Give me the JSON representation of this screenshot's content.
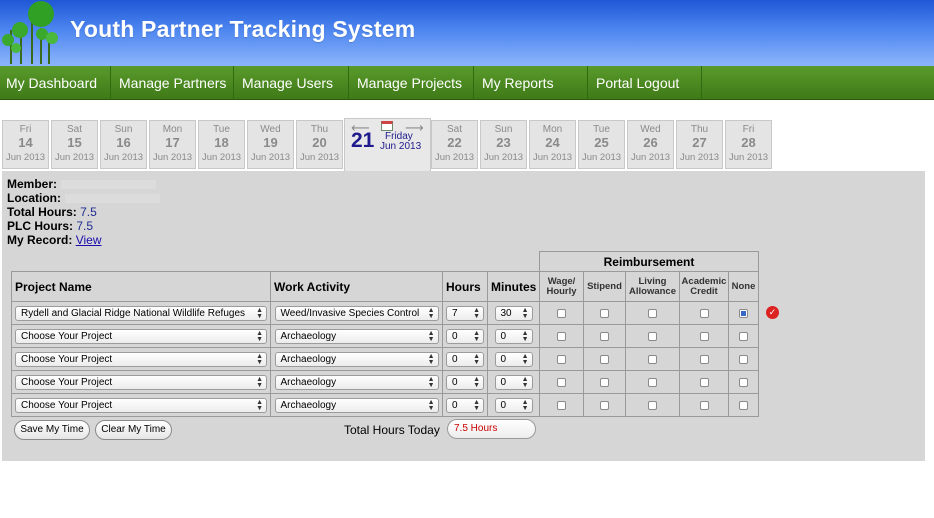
{
  "app": {
    "title": "Youth Partner Tracking System"
  },
  "nav": {
    "items": [
      {
        "label": "My Dashboard"
      },
      {
        "label": "Manage Partners"
      },
      {
        "label": "Manage Users"
      },
      {
        "label": "Manage Projects"
      },
      {
        "label": "My Reports"
      },
      {
        "label": "Portal Logout"
      }
    ]
  },
  "dates": {
    "before": [
      {
        "dayname": "Fri",
        "day": "14",
        "month": "Jun 2013"
      },
      {
        "dayname": "Sat",
        "day": "15",
        "month": "Jun 2013"
      },
      {
        "dayname": "Sun",
        "day": "16",
        "month": "Jun 2013"
      },
      {
        "dayname": "Mon",
        "day": "17",
        "month": "Jun 2013"
      },
      {
        "dayname": "Tue",
        "day": "18",
        "month": "Jun 2013"
      },
      {
        "dayname": "Wed",
        "day": "19",
        "month": "Jun 2013"
      },
      {
        "dayname": "Thu",
        "day": "20",
        "month": "Jun 2013"
      }
    ],
    "active": {
      "day": "21",
      "dayname": "Friday",
      "month": "Jun 2013"
    },
    "after": [
      {
        "dayname": "Sat",
        "day": "22",
        "month": "Jun 2013"
      },
      {
        "dayname": "Sun",
        "day": "23",
        "month": "Jun 2013"
      },
      {
        "dayname": "Mon",
        "day": "24",
        "month": "Jun 2013"
      },
      {
        "dayname": "Tue",
        "day": "25",
        "month": "Jun 2013"
      },
      {
        "dayname": "Wed",
        "day": "26",
        "month": "Jun 2013"
      },
      {
        "dayname": "Thu",
        "day": "27",
        "month": "Jun 2013"
      },
      {
        "dayname": "Fri",
        "day": "28",
        "month": "Jun 2013"
      }
    ]
  },
  "info": {
    "member_label": "Member:",
    "location_label": "Location:",
    "total_hours_label": "Total Hours:",
    "total_hours_value": "7.5",
    "plc_hours_label": "PLC Hours:",
    "plc_hours_value": "7.5",
    "record_label": "My Record:",
    "record_link": "View"
  },
  "table": {
    "reimbursement_title": "Reimbursement",
    "headers": {
      "project": "Project Name",
      "activity": "Work Activity",
      "hours": "Hours",
      "minutes": "Minutes",
      "wage": "Wage/ Hourly",
      "stipend": "Stipend",
      "living": "Living Allowance",
      "academic": "Academic Credit",
      "none": "None"
    },
    "rows": [
      {
        "project": "Rydell and Glacial Ridge National Wildlife Refuges",
        "activity": "Weed/Invasive Species Control",
        "hours": "7",
        "minutes": "30"
      },
      {
        "project": "Choose Your Project",
        "activity": "Archaeology",
        "hours": "0",
        "minutes": "0"
      },
      {
        "project": "Choose Your Project",
        "activity": "Archaeology",
        "hours": "0",
        "minutes": "0"
      },
      {
        "project": "Choose Your Project",
        "activity": "Archaeology",
        "hours": "0",
        "minutes": "0"
      },
      {
        "project": "Choose Your Project",
        "activity": "Archaeology",
        "hours": "0",
        "minutes": "0"
      }
    ]
  },
  "buttons": {
    "save": "Save My Time",
    "clear": "Clear My Time"
  },
  "totals": {
    "label": "Total Hours Today",
    "value": "7.5 Hours"
  }
}
